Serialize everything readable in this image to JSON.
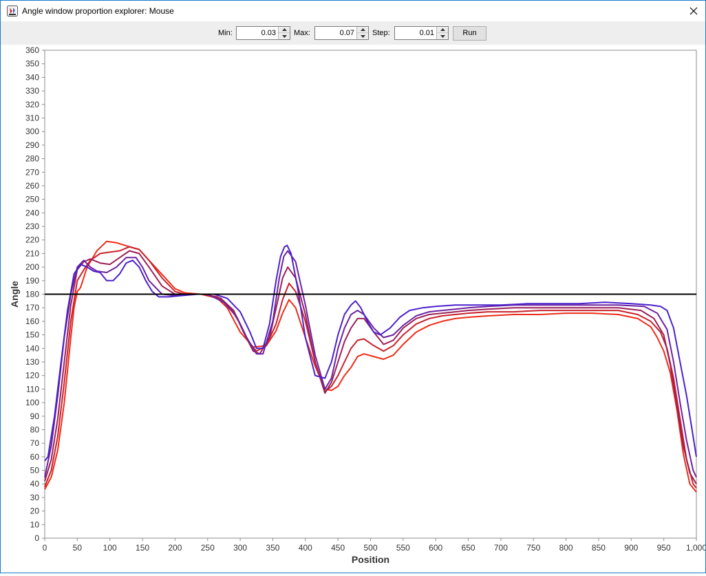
{
  "window": {
    "title": "Angle window proportion explorer: Mouse",
    "app_icon": "java-app-icon",
    "close_icon": "close-icon"
  },
  "controls": {
    "min_label": "Min:",
    "min_value": "0.03",
    "max_label": "Max:",
    "max_value": "0.07",
    "step_label": "Step:",
    "step_value": "0.01",
    "run_label": "Run"
  },
  "colors": {
    "series_0.03": "#ee2b16",
    "series_0.04": "#c8202c",
    "series_0.05": "#9a1f58",
    "series_0.06": "#6b22a0",
    "series_0.07": "#4a20cc",
    "reference_line": "#000000"
  },
  "chart_data": {
    "type": "line",
    "xlabel": "Position",
    "ylabel": "Angle",
    "xlim": [
      0,
      1000
    ],
    "ylim": [
      0,
      360
    ],
    "xticks": [
      "0",
      "50",
      "100",
      "150",
      "200",
      "250",
      "300",
      "350",
      "400",
      "450",
      "500",
      "550",
      "600",
      "650",
      "700",
      "750",
      "800",
      "850",
      "900",
      "950",
      "1,000"
    ],
    "yticks": [
      "0",
      "10",
      "20",
      "30",
      "40",
      "50",
      "60",
      "70",
      "80",
      "90",
      "100",
      "110",
      "120",
      "130",
      "140",
      "150",
      "160",
      "170",
      "180",
      "190",
      "200",
      "210",
      "220",
      "230",
      "240",
      "250",
      "260",
      "270",
      "280",
      "290",
      "300",
      "310",
      "320",
      "330",
      "340",
      "350",
      "360"
    ],
    "grid": false,
    "legend": false,
    "reference_line_y": 180,
    "series": [
      {
        "key": "0.03",
        "x": [
          0,
          10,
          20,
          30,
          40,
          45,
          50,
          55,
          65,
          80,
          95,
          110,
          130,
          145,
          160,
          185,
          200,
          215,
          240,
          265,
          280,
          300,
          320,
          340,
          355,
          365,
          375,
          385,
          400,
          415,
          430,
          440,
          450,
          460,
          470,
          480,
          490,
          505,
          520,
          535,
          550,
          570,
          590,
          610,
          630,
          650,
          680,
          720,
          760,
          800,
          840,
          880,
          910,
          930,
          940,
          950,
          960,
          970,
          980,
          990,
          1000
        ],
        "y": [
          36,
          45,
          65,
          100,
          148,
          170,
          182,
          185,
          200,
          212,
          219,
          218,
          215,
          213,
          205,
          192,
          184,
          181,
          180,
          177,
          170,
          152,
          141,
          142,
          153,
          166,
          176,
          170,
          148,
          127,
          110,
          109,
          112,
          120,
          126,
          134,
          136,
          134,
          132,
          135,
          143,
          152,
          157,
          160,
          162,
          163,
          164,
          165,
          165,
          166,
          166,
          165,
          162,
          156,
          148,
          138,
          122,
          95,
          62,
          40,
          34
        ]
      },
      {
        "key": "0.04",
        "x": [
          0,
          10,
          20,
          30,
          40,
          50,
          60,
          70,
          85,
          100,
          115,
          130,
          145,
          160,
          180,
          200,
          215,
          240,
          265,
          285,
          300,
          315,
          325,
          340,
          355,
          365,
          375,
          385,
          400,
          415,
          430,
          440,
          450,
          460,
          470,
          480,
          490,
          505,
          520,
          535,
          550,
          570,
          590,
          610,
          630,
          650,
          680,
          720,
          760,
          800,
          840,
          880,
          910,
          930,
          945,
          955,
          965,
          975,
          985,
          995,
          1000
        ],
        "y": [
          38,
          50,
          75,
          115,
          160,
          190,
          198,
          205,
          210,
          211,
          212,
          215,
          213,
          205,
          192,
          182,
          180,
          180,
          178,
          170,
          158,
          143,
          138,
          142,
          158,
          176,
          188,
          182,
          160,
          130,
          108,
          112,
          120,
          130,
          140,
          146,
          147,
          142,
          138,
          142,
          150,
          158,
          162,
          164,
          165,
          166,
          167,
          167,
          168,
          168,
          168,
          168,
          165,
          160,
          152,
          140,
          118,
          88,
          58,
          40,
          37
        ]
      },
      {
        "key": "0.05",
        "x": [
          0,
          10,
          20,
          30,
          40,
          50,
          60,
          70,
          85,
          100,
          115,
          130,
          145,
          160,
          180,
          200,
          220,
          245,
          270,
          290,
          305,
          320,
          330,
          345,
          358,
          365,
          373,
          385,
          400,
          415,
          430,
          440,
          450,
          460,
          470,
          480,
          490,
          505,
          520,
          535,
          550,
          570,
          590,
          610,
          630,
          650,
          680,
          720,
          760,
          800,
          840,
          880,
          915,
          935,
          950,
          960,
          970,
          980,
          990,
          1000
        ],
        "y": [
          42,
          58,
          88,
          130,
          172,
          198,
          204,
          206,
          203,
          202,
          207,
          212,
          210,
          200,
          186,
          180,
          180,
          180,
          177,
          168,
          152,
          138,
          136,
          148,
          176,
          192,
          200,
          192,
          165,
          130,
          107,
          115,
          130,
          145,
          155,
          162,
          162,
          152,
          143,
          146,
          155,
          162,
          165,
          166,
          167,
          168,
          169,
          170,
          170,
          170,
          170,
          170,
          168,
          162,
          150,
          128,
          98,
          68,
          48,
          40
        ]
      },
      {
        "key": "0.06",
        "x": [
          0,
          10,
          20,
          30,
          40,
          50,
          60,
          70,
          80,
          95,
          110,
          125,
          140,
          150,
          160,
          180,
          200,
          225,
          250,
          275,
          295,
          310,
          325,
          335,
          350,
          360,
          367,
          373,
          385,
          400,
          415,
          430,
          440,
          450,
          460,
          470,
          480,
          490,
          505,
          520,
          535,
          550,
          570,
          590,
          610,
          630,
          650,
          680,
          720,
          760,
          800,
          840,
          880,
          920,
          940,
          955,
          965,
          975,
          985,
          995,
          1000
        ],
        "y": [
          45,
          68,
          105,
          148,
          180,
          200,
          205,
          200,
          197,
          196,
          200,
          207,
          207,
          200,
          190,
          180,
          179,
          180,
          180,
          174,
          163,
          148,
          136,
          136,
          160,
          192,
          208,
          212,
          204,
          172,
          135,
          110,
          118,
          140,
          155,
          165,
          168,
          165,
          155,
          148,
          150,
          157,
          164,
          167,
          168,
          169,
          170,
          171,
          172,
          172,
          172,
          172,
          172,
          171,
          166,
          154,
          130,
          100,
          72,
          50,
          45
        ]
      },
      {
        "key": "0.07",
        "x": [
          0,
          5,
          15,
          25,
          35,
          45,
          55,
          65,
          75,
          85,
          95,
          105,
          115,
          125,
          135,
          145,
          155,
          165,
          175,
          190,
          210,
          235,
          260,
          280,
          300,
          315,
          325,
          335,
          345,
          355,
          362,
          368,
          372,
          378,
          388,
          400,
          415,
          430,
          440,
          450,
          460,
          470,
          477,
          485,
          495,
          505,
          515,
          530,
          545,
          560,
          580,
          600,
          630,
          660,
          700,
          740,
          780,
          820,
          860,
          900,
          930,
          945,
          955,
          965,
          975,
          985,
          995,
          1000
        ],
        "y": [
          57,
          60,
          90,
          130,
          168,
          195,
          202,
          200,
          197,
          196,
          190,
          190,
          195,
          203,
          205,
          200,
          190,
          182,
          178,
          178,
          179,
          180,
          180,
          177,
          167,
          152,
          140,
          140,
          158,
          190,
          208,
          215,
          216,
          210,
          185,
          148,
          120,
          118,
          130,
          150,
          165,
          172,
          175,
          170,
          160,
          152,
          150,
          155,
          163,
          168,
          170,
          171,
          172,
          172,
          172,
          173,
          173,
          173,
          174,
          173,
          172,
          171,
          168,
          155,
          130,
          105,
          75,
          60
        ]
      }
    ]
  }
}
